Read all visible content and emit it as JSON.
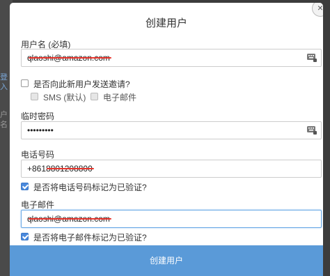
{
  "background": {
    "fragment_1": "登入",
    "fragment_2": "户名"
  },
  "dialog": {
    "title": "创建用户",
    "close_glyph": "×",
    "username": {
      "label": "用户名 (必填)",
      "value": "qlaoshi@amazon.com"
    },
    "invite": {
      "label": "是否向此新用户发送邀请?",
      "checked": false,
      "options": [
        {
          "label": "SMS (默认)",
          "enabled": false
        },
        {
          "label": "电子邮件",
          "enabled": false
        }
      ]
    },
    "temp_password": {
      "label": "临时密码",
      "value": "•••••••••"
    },
    "phone": {
      "label": "电话号码",
      "value": "+8618801208800",
      "verify_label": "是否将电话号码标记为已验证?",
      "verify_checked": true
    },
    "email": {
      "label": "电子邮件",
      "value": "qlaoshi@amazon.com",
      "verify_label": "是否将电子邮件标记为已验证?",
      "verify_checked": true
    },
    "submit_label": "创建用户"
  },
  "icons": {
    "keyboard": "keyboard-icon",
    "close": "close-icon"
  },
  "colors": {
    "primary": "#5a9ad8",
    "checkbox_checked": "#4a89dc",
    "redaction": "#e8342c"
  }
}
